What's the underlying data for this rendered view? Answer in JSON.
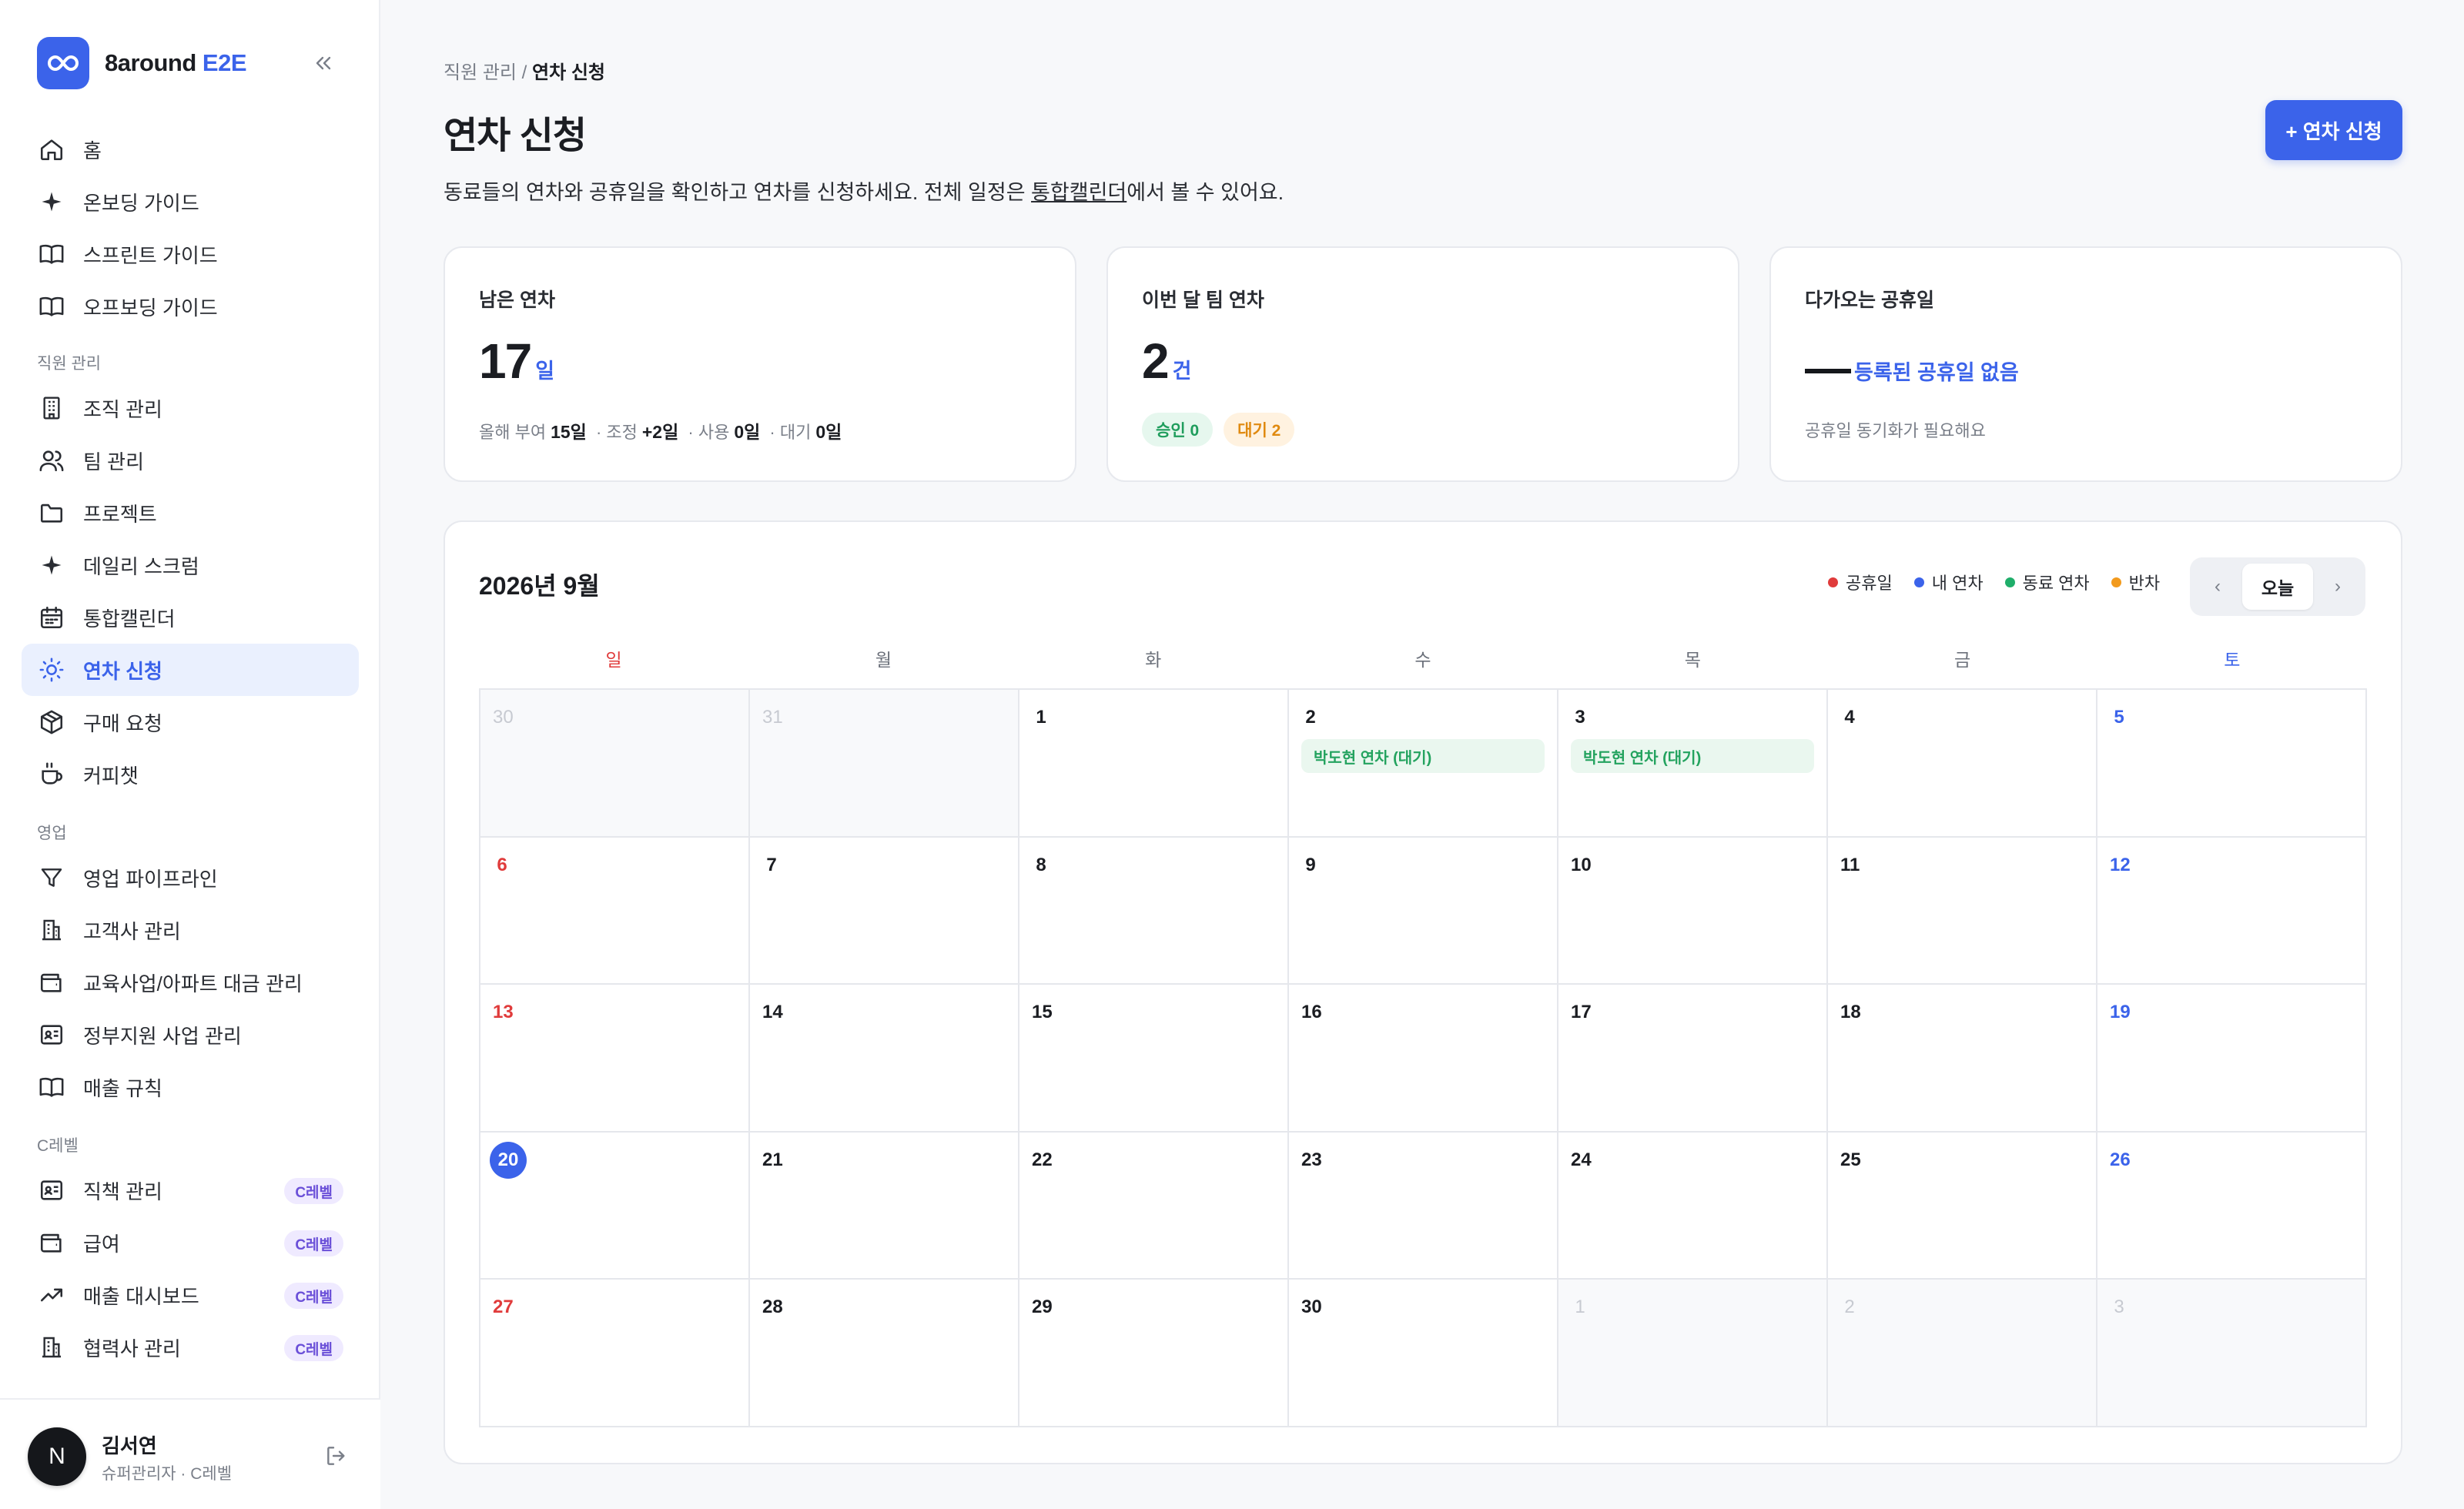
{
  "brand": {
    "name_prefix": "8around ",
    "name_accent": "E2E"
  },
  "sidebar": {
    "items": [
      {
        "label": "홈",
        "icon": "home-icon"
      },
      {
        "label": "온보딩 가이드",
        "icon": "sparkle-icon"
      },
      {
        "label": "스프린트 가이드",
        "icon": "book-icon"
      },
      {
        "label": "오프보딩 가이드",
        "icon": "book-icon"
      },
      {
        "label": "조직 관리",
        "icon": "building-icon"
      },
      {
        "label": "팀 관리",
        "icon": "users-icon"
      },
      {
        "label": "프로젝트",
        "icon": "folder-icon"
      },
      {
        "label": "데일리 스크럼",
        "icon": "sparkle-icon"
      },
      {
        "label": "통합캘린더",
        "icon": "calendar-icon"
      },
      {
        "label": "연차 신청",
        "icon": "sun-icon",
        "active": true
      },
      {
        "label": "구매 요청",
        "icon": "package-icon"
      },
      {
        "label": "커피챗",
        "icon": "coffee-icon"
      },
      {
        "label": "영업 파이프라인",
        "icon": "filter-icon"
      },
      {
        "label": "고객사 관리",
        "icon": "office-icon"
      },
      {
        "label": "교육사업/아파트 대금 관리",
        "icon": "wallet-icon"
      },
      {
        "label": "정부지원 사업 관리",
        "icon": "id-card-icon"
      },
      {
        "label": "매출 규칙",
        "icon": "book-icon"
      },
      {
        "label": "직책 관리",
        "icon": "id-card-icon",
        "badge": "C레벨"
      },
      {
        "label": "급여",
        "icon": "wallet-icon",
        "badge": "C레벨"
      },
      {
        "label": "매출 대시보드",
        "icon": "trend-icon",
        "badge": "C레벨"
      },
      {
        "label": "협력사 관리",
        "icon": "office-icon",
        "badge": "C레벨"
      }
    ],
    "sections": [
      "직원 관리",
      "영업",
      "C레벨"
    ]
  },
  "user": {
    "initial": "N",
    "name": "김서연",
    "role": "슈퍼관리자 · C레벨"
  },
  "header": {
    "breadcrumb_parent": "직원 관리 / ",
    "breadcrumb_current": "연차 신청",
    "title": "연차 신청",
    "desc_before": "동료들의 연차와 공휴일을 확인하고 연차를 신청하세요. 전체 일정은 ",
    "desc_link": "통합캘린더",
    "desc_after": "에서 볼 수 있어요.",
    "primary_button": "+ 연차 신청"
  },
  "cards": {
    "remaining": {
      "title": "남은 연차",
      "value": "17",
      "unit": "일",
      "granted_label": "올해 부여",
      "granted": "15일",
      "adjust_label": "· 조정",
      "adjust": "+2일",
      "used_label": "· 사용",
      "used": "0일",
      "pending_label": "· 대기",
      "pending": "0일"
    },
    "team": {
      "title": "이번 달 팀 연차",
      "value": "2",
      "unit": "건",
      "approved": "승인 0",
      "waiting": "대기 2"
    },
    "holiday": {
      "title": "다가오는 공휴일",
      "empty": "등록된 공휴일 없음",
      "note": "공휴일 동기화가 필요해요"
    }
  },
  "calendar": {
    "title": "2026년 9월",
    "legend": [
      {
        "label": "공휴일",
        "color": "#e03b3b"
      },
      {
        "label": "내 연차",
        "color": "#3b63ea"
      },
      {
        "label": "동료 연차",
        "color": "#1fae6a"
      },
      {
        "label": "반차",
        "color": "#f29a1d"
      }
    ],
    "prev": "‹",
    "today": "오늘",
    "next": "›",
    "weekdays": [
      "일",
      "월",
      "화",
      "수",
      "목",
      "금",
      "토"
    ],
    "days": [
      "30",
      "31",
      "1",
      "2",
      "3",
      "4",
      "5",
      "6",
      "7",
      "8",
      "9",
      "10",
      "11",
      "12",
      "13",
      "14",
      "15",
      "16",
      "17",
      "18",
      "19",
      "20",
      "21",
      "22",
      "23",
      "24",
      "25",
      "26",
      "27",
      "28",
      "29",
      "30",
      "1",
      "2",
      "3"
    ],
    "events": {
      "3": "박도현 연차 (대기)",
      "4": "박도현 연차 (대기)"
    },
    "out_of_month": [
      0,
      1,
      32,
      33,
      34
    ],
    "today_index": 21
  },
  "colors": {
    "accent": "#3b63ea",
    "sunday": "#e03b3b",
    "saturday": "#3b63ea",
    "event_green": "#24a35f"
  }
}
